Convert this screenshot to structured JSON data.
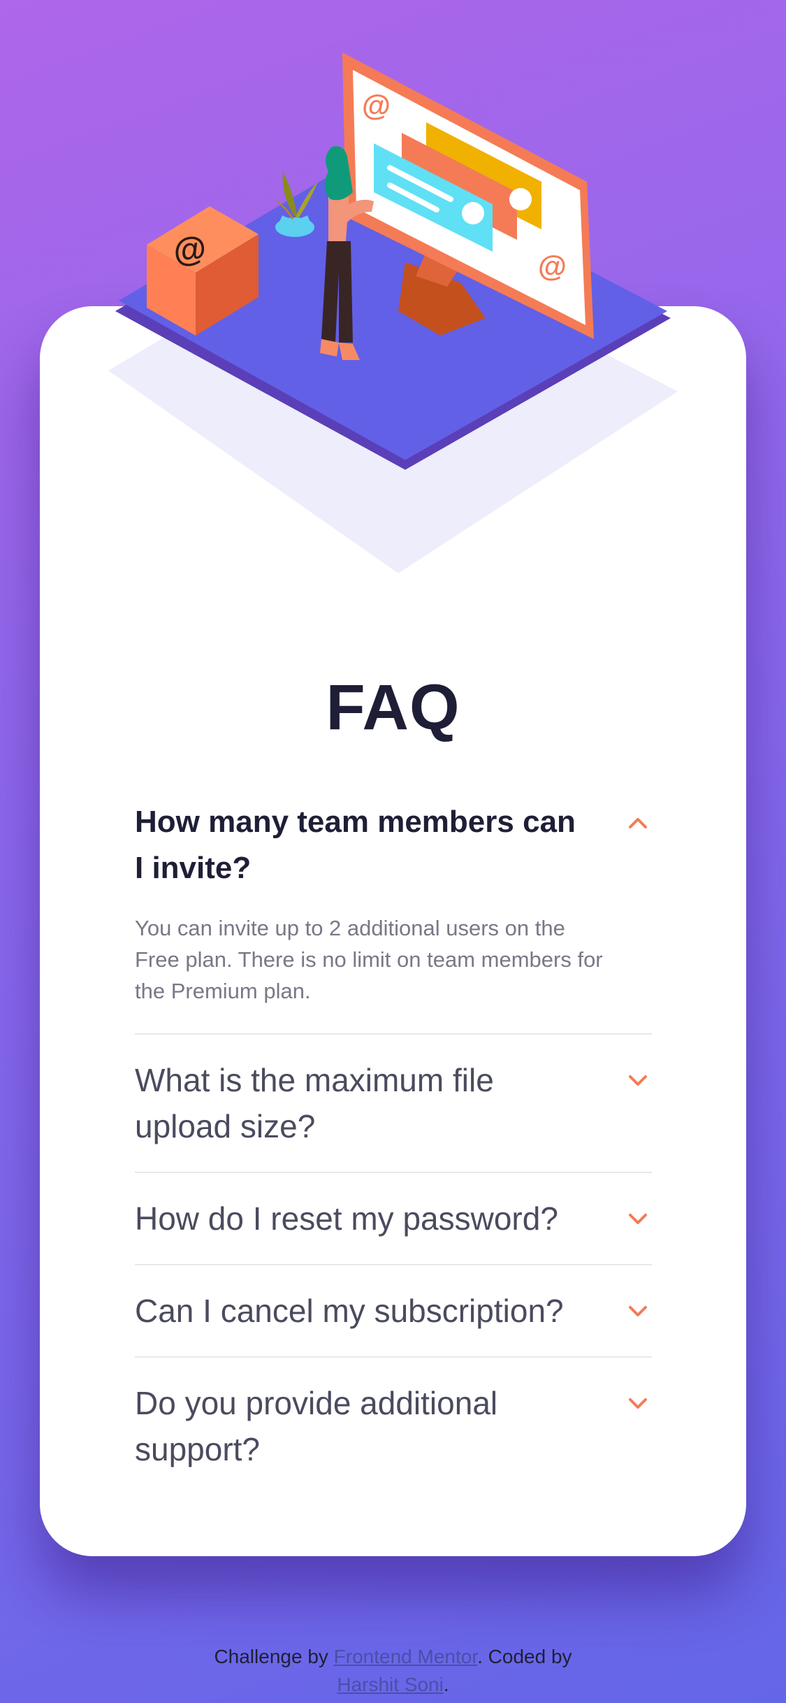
{
  "page": {
    "title": "FAQ"
  },
  "faq": {
    "items": [
      {
        "question": "How many team members can I invite?",
        "answer": "You can invite up to 2 additional users on the Free plan. There is no limit on team members for the Premium plan.",
        "open": true
      },
      {
        "question": "What is the maximum file upload size?",
        "open": false
      },
      {
        "question": "How do I reset my password?",
        "open": false
      },
      {
        "question": "Can I cancel my subscription?",
        "open": false
      },
      {
        "question": "Do you provide additional support?",
        "open": false
      }
    ]
  },
  "attribution": {
    "prefix": "Challenge by ",
    "link1": "Frontend Mentor",
    "middle": ". Coded by",
    "link2": "Harshit Soni",
    "suffix": "."
  },
  "colors": {
    "accent": "#f47b56",
    "title": "#1e1f36",
    "question": "#4a4b5e",
    "answer": "#787887",
    "divider": "#e8e8ea",
    "bg_start": "#ae66ea",
    "bg_end": "#6466e8"
  },
  "icons": {
    "open": "chevron-up-icon",
    "closed": "chevron-down-icon"
  }
}
